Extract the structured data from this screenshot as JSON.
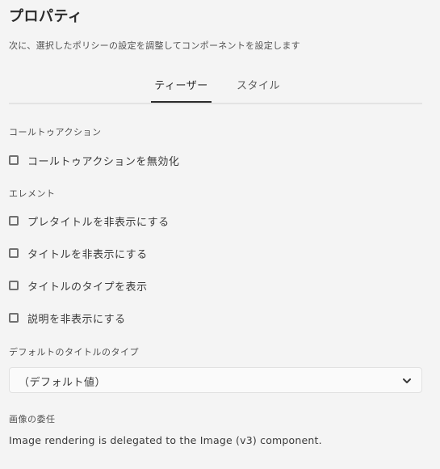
{
  "header": {
    "title": "プロパティ",
    "subtitle": "次に、選択したポリシーの設定を調整してコンポーネントを設定します"
  },
  "tabs": [
    {
      "label": "ティーザー",
      "selected": true
    },
    {
      "label": "スタイル",
      "selected": false
    }
  ],
  "cta_section": {
    "label": "コールトゥアクション",
    "checkboxes": [
      {
        "label": "コールトゥアクションを無効化",
        "checked": false
      }
    ]
  },
  "element_section": {
    "label": "エレメント",
    "checkboxes": [
      {
        "label": "プレタイトルを非表示にする",
        "checked": false
      },
      {
        "label": "タイトルを非表示にする",
        "checked": false
      },
      {
        "label": "タイトルのタイプを表示",
        "checked": false
      },
      {
        "label": "説明を非表示にする",
        "checked": false
      }
    ]
  },
  "default_title_type": {
    "label": "デフォルトのタイトルのタイプ",
    "value": "（デフォルト値）",
    "icon": "chevron-down-icon"
  },
  "image_delegation": {
    "label": "画像の委任",
    "text": "Image rendering is delegated to the Image (v3) component."
  }
}
